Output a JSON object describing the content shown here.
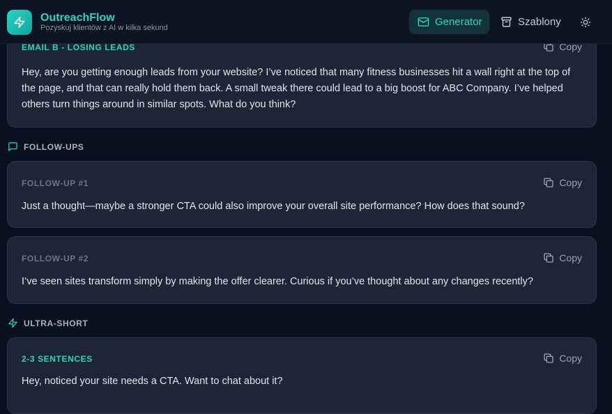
{
  "header": {
    "brand_title": "OutreachFlow",
    "brand_subtitle": "Pozyskuj klientów z AI w kilka sekund",
    "nav": [
      {
        "label": "Generator",
        "icon": "mail-icon",
        "active": true
      },
      {
        "label": "Szablony",
        "icon": "archive-icon",
        "active": false
      }
    ],
    "theme_icon": "sun-icon"
  },
  "email_b": {
    "label": "EMAIL B - LOSING LEADS",
    "copy_label": "Copy",
    "text": "Hey, are you getting enough leads from your website? I’ve noticed that many fitness businesses hit a wall right at the top of the page, and that can really hold them back. A small tweak there could lead to a big boost for ABC Company. I’ve helped others turn things around in similar spots. What do you think?"
  },
  "followups": {
    "heading": "FOLLOW-UPS",
    "items": [
      {
        "label": "FOLLOW-UP #1",
        "copy_label": "Copy",
        "text": "Just a thought—maybe a stronger CTA could also improve your overall site performance? How does that sound?"
      },
      {
        "label": "FOLLOW-UP #2",
        "copy_label": "Copy",
        "text": "I’ve seen sites transform simply by making the offer clearer. Curious if you’ve thought about any changes recently?"
      }
    ]
  },
  "ultra_short": {
    "heading": "ULTRA-SHORT",
    "label": "2-3 SENTENCES",
    "copy_label": "Copy",
    "text": "Hey, noticed your site needs a CTA. Want to chat about it?"
  },
  "colors": {
    "accent": "#2dd4bf",
    "background": "#0a1020",
    "card": "#1c2637"
  }
}
